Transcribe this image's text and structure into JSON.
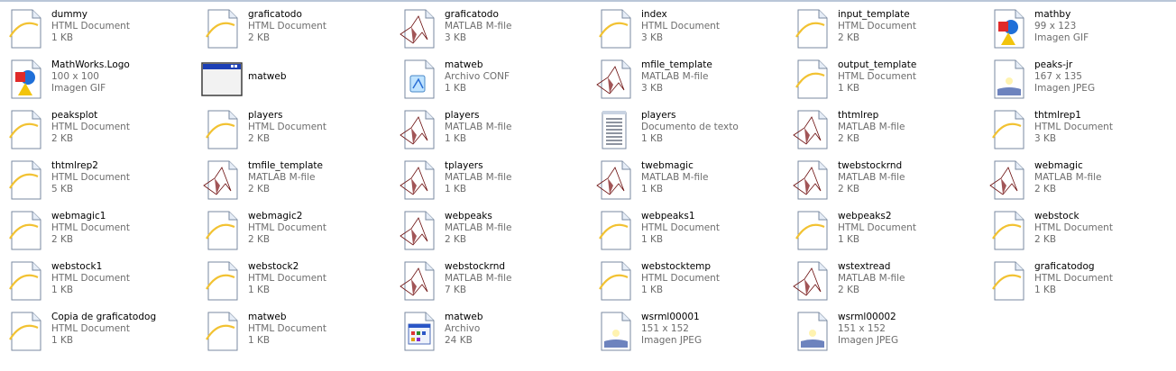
{
  "items": [
    {
      "name": "dummy",
      "type": "HTML Document",
      "size": "1 KB",
      "icon": "ie-html-icon"
    },
    {
      "name": "graficatodo",
      "type": "HTML Document",
      "size": "2 KB",
      "icon": "ie-html-icon"
    },
    {
      "name": "graficatodo",
      "type": "MATLAB M-file",
      "size": "3 KB",
      "icon": "matlab-mfile-icon"
    },
    {
      "name": "index",
      "type": "HTML Document",
      "size": "3 KB",
      "icon": "ie-html-icon"
    },
    {
      "name": "input_template",
      "type": "HTML Document",
      "size": "2 KB",
      "icon": "ie-html-icon"
    },
    {
      "name": "mathby",
      "type": "99 x 123",
      "size": "Imagen GIF",
      "icon": "gif-image-icon"
    },
    {
      "name": "MathWorks.Logo",
      "type": "100 x 100",
      "size": "Imagen GIF",
      "icon": "gif-image-icon"
    },
    {
      "name": "matweb",
      "type": "",
      "size": "",
      "icon": "application-window-icon"
    },
    {
      "name": "matweb",
      "type": "Archivo CONF",
      "size": "1 KB",
      "icon": "conf-file-icon"
    },
    {
      "name": "mfile_template",
      "type": "MATLAB M-file",
      "size": "3 KB",
      "icon": "matlab-mfile-icon"
    },
    {
      "name": "output_template",
      "type": "HTML Document",
      "size": "1 KB",
      "icon": "ie-html-icon"
    },
    {
      "name": "peaks-jr",
      "type": "167 x 135",
      "size": "Imagen JPEG",
      "icon": "jpeg-image-icon"
    },
    {
      "name": "peaksplot",
      "type": "HTML Document",
      "size": "2 KB",
      "icon": "ie-html-icon"
    },
    {
      "name": "players",
      "type": "HTML Document",
      "size": "2 KB",
      "icon": "ie-html-icon"
    },
    {
      "name": "players",
      "type": "MATLAB M-file",
      "size": "1 KB",
      "icon": "matlab-mfile-icon"
    },
    {
      "name": "players",
      "type": "Documento de texto",
      "size": "1 KB",
      "icon": "text-document-icon"
    },
    {
      "name": "thtmlrep",
      "type": "MATLAB M-file",
      "size": "2 KB",
      "icon": "matlab-mfile-icon"
    },
    {
      "name": "thtmlrep1",
      "type": "HTML Document",
      "size": "3 KB",
      "icon": "ie-html-icon"
    },
    {
      "name": "thtmlrep2",
      "type": "HTML Document",
      "size": "5 KB",
      "icon": "ie-html-icon"
    },
    {
      "name": "tmfile_template",
      "type": "MATLAB M-file",
      "size": "2 KB",
      "icon": "matlab-mfile-icon"
    },
    {
      "name": "tplayers",
      "type": "MATLAB M-file",
      "size": "1 KB",
      "icon": "matlab-mfile-icon"
    },
    {
      "name": "twebmagic",
      "type": "MATLAB M-file",
      "size": "1 KB",
      "icon": "matlab-mfile-icon"
    },
    {
      "name": "twebstockrnd",
      "type": "MATLAB M-file",
      "size": "2 KB",
      "icon": "matlab-mfile-icon"
    },
    {
      "name": "webmagic",
      "type": "MATLAB M-file",
      "size": "2 KB",
      "icon": "matlab-mfile-icon"
    },
    {
      "name": "webmagic1",
      "type": "HTML Document",
      "size": "2 KB",
      "icon": "ie-html-icon"
    },
    {
      "name": "webmagic2",
      "type": "HTML Document",
      "size": "2 KB",
      "icon": "ie-html-icon"
    },
    {
      "name": "webpeaks",
      "type": "MATLAB M-file",
      "size": "2 KB",
      "icon": "matlab-mfile-icon"
    },
    {
      "name": "webpeaks1",
      "type": "HTML Document",
      "size": "1 KB",
      "icon": "ie-html-icon"
    },
    {
      "name": "webpeaks2",
      "type": "HTML Document",
      "size": "1 KB",
      "icon": "ie-html-icon"
    },
    {
      "name": "webstock",
      "type": "HTML Document",
      "size": "2 KB",
      "icon": "ie-html-icon"
    },
    {
      "name": "webstock1",
      "type": "HTML Document",
      "size": "1 KB",
      "icon": "ie-html-icon"
    },
    {
      "name": "webstock2",
      "type": "HTML Document",
      "size": "1 KB",
      "icon": "ie-html-icon"
    },
    {
      "name": "webstockrnd",
      "type": "MATLAB M-file",
      "size": "7 KB",
      "icon": "matlab-mfile-icon"
    },
    {
      "name": "webstocktemp",
      "type": "HTML Document",
      "size": "1 KB",
      "icon": "ie-html-icon"
    },
    {
      "name": "wstextread",
      "type": "MATLAB M-file",
      "size": "2 KB",
      "icon": "matlab-mfile-icon"
    },
    {
      "name": "graficatodog",
      "type": "HTML Document",
      "size": "1 KB",
      "icon": "ie-html-icon"
    },
    {
      "name": "Copia de graficatodog",
      "type": "HTML Document",
      "size": "1 KB",
      "icon": "ie-html-icon"
    },
    {
      "name": "matweb",
      "type": "HTML Document",
      "size": "1 KB",
      "icon": "ie-html-icon"
    },
    {
      "name": "matweb",
      "type": "Archivo",
      "size": "24 KB",
      "icon": "generic-file-icon"
    },
    {
      "name": "wsrml00001",
      "type": "151 x 152",
      "size": "Imagen JPEG",
      "icon": "jpeg-image-icon"
    },
    {
      "name": "wsrml00002",
      "type": "151 x 152",
      "size": "Imagen JPEG",
      "icon": "jpeg-image-icon"
    }
  ],
  "colors": {
    "secondary_text": "#6d6d6d",
    "ie_blue": "#2a6fd6",
    "matlab_red": "#c0141a",
    "matlab_orange": "#f08a1c"
  }
}
